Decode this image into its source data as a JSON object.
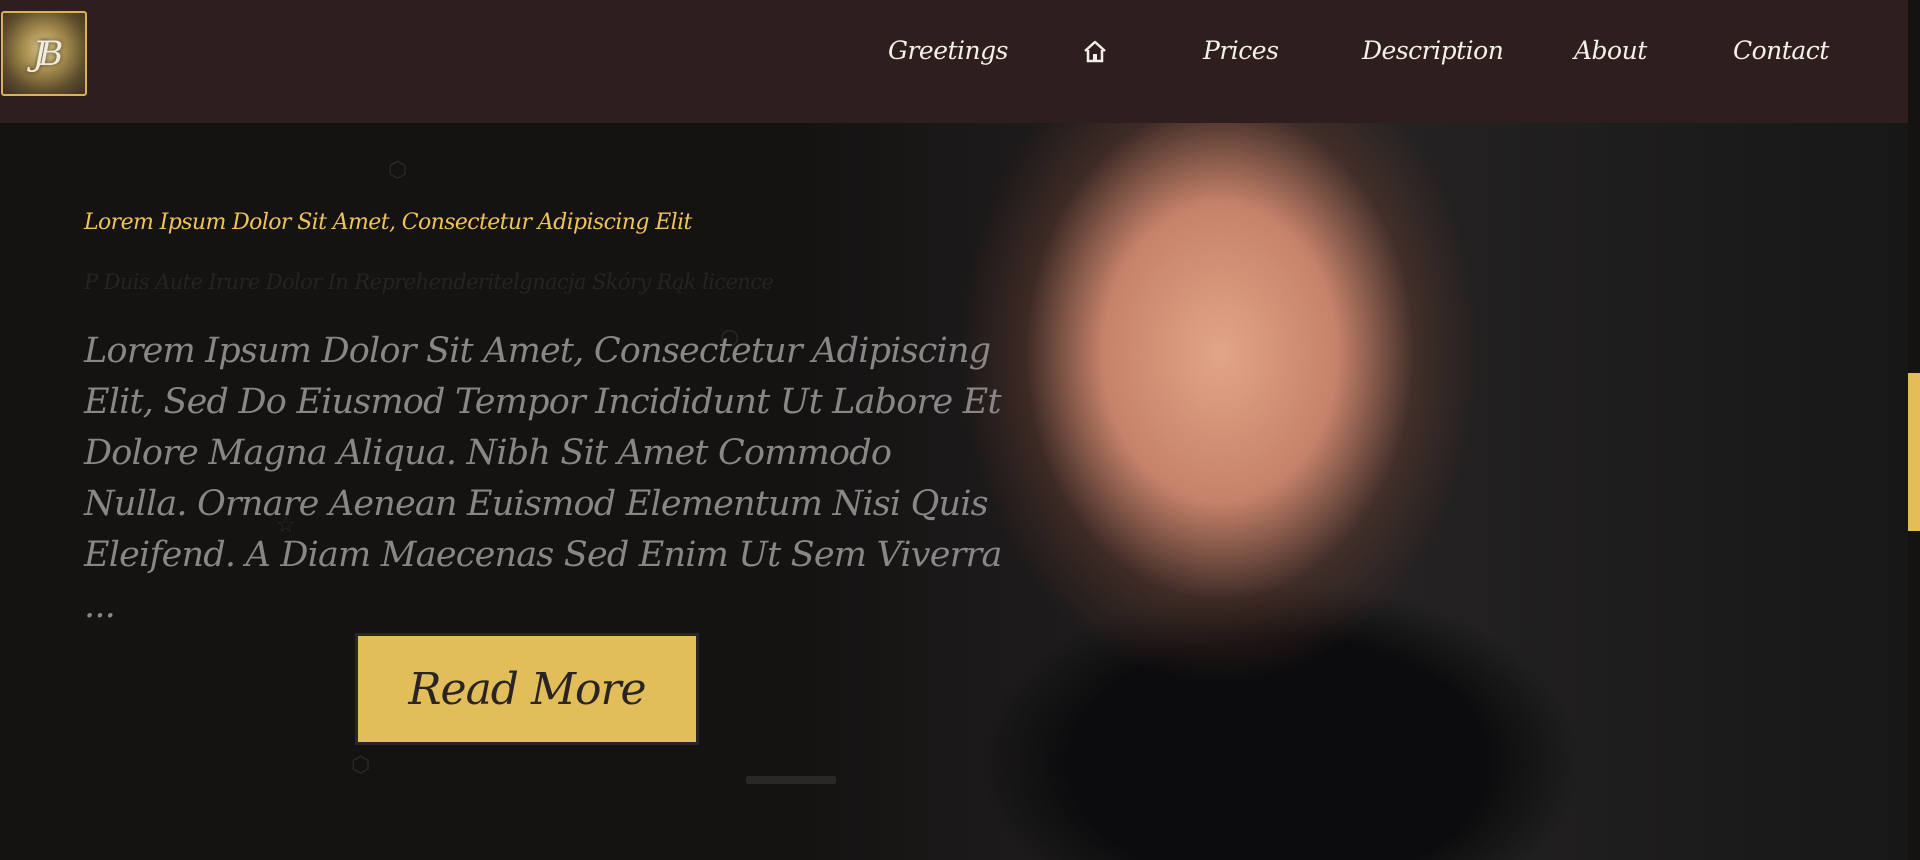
{
  "header": {
    "logo_text": "JB",
    "nav": {
      "greetings": "Greetings",
      "home_icon": "home-icon",
      "prices": "Prices",
      "description": "Description",
      "about": "About",
      "contact": "Contact"
    }
  },
  "hero": {
    "subtitle": "Lorem Ipsum Dolor Sit Amet, Consectetur Adipiscing Elit",
    "faint_line": "P Duis Aute Irure Dolor In Reprehenderitelgnacja Skóry Rąk licence",
    "body": "Lorem Ipsum Dolor Sit Amet, Consectetur Adipiscing Elit, Sed Do Eiusmod Tempor Incididunt Ut Labore Et Dolore Magna Aliqua. Nibh Sit Amet Commodo Nulla. Ornare Aenean Euismod Elementum Nisi Quis Eleifend. A Diam Maecenas Sed Enim Ut Sem Viverra ...",
    "read_more": "Read More"
  },
  "colors": {
    "header_bg": "#2e1e1d",
    "page_bg": "#151212",
    "accent_gold": "#e2be5b",
    "subtitle_gold": "#efc359",
    "body_text": "#8b8686"
  }
}
